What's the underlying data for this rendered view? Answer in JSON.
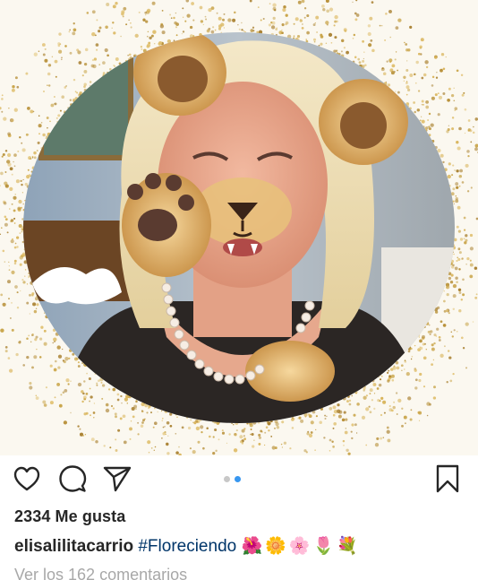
{
  "post": {
    "image_description_icon": "lion-filter-portrait",
    "likes_text": "2334 Me gusta",
    "caption": {
      "username": "elisalilitacarrio",
      "hashtag": "#Floreciendo",
      "emojis": "🌺🌼🌸🌷💐"
    },
    "view_comments": "Ver los 162 comentarios",
    "carousel": {
      "count": 2,
      "active_index": 1
    }
  },
  "actions": {
    "like_icon": "heart-icon",
    "comment_icon": "comment-bubble-icon",
    "share_icon": "paper-plane-icon",
    "save_icon": "bookmark-icon"
  },
  "colors": {
    "accent_blue": "#3897f0",
    "hashtag": "#003569",
    "glitter_gold": "#c9a54a",
    "text": "#262626",
    "muted": "#a8a8a8"
  }
}
